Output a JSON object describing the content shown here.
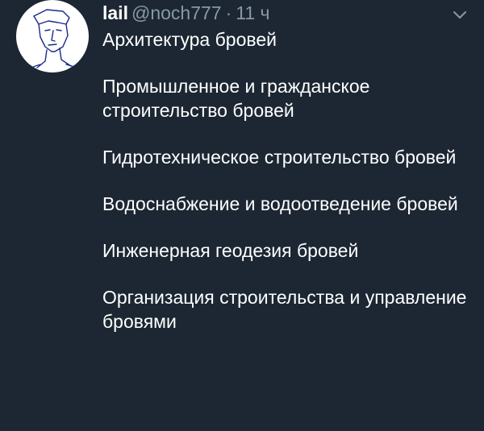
{
  "tweet": {
    "author": {
      "display_name": "lail",
      "handle": "@noch777",
      "separator": "·",
      "time": "11 ч",
      "avatar_icon": "sketched-face-avatar"
    },
    "menu_icon": "chevron-down-icon",
    "lines": [
      "Архитектура бровей",
      "Промышленное и гражданское строительство бровей",
      "Гидротехническое строительство бровей",
      "Водоснабжение и водоотведение бровей",
      "Инженерная геодезия бровей",
      "Организация строительства и управление бровями"
    ]
  },
  "colors": {
    "background": "#1c2733",
    "text_primary": "#ffffff",
    "text_secondary": "#8899a6",
    "avatar_line": "#1a2a8c"
  }
}
